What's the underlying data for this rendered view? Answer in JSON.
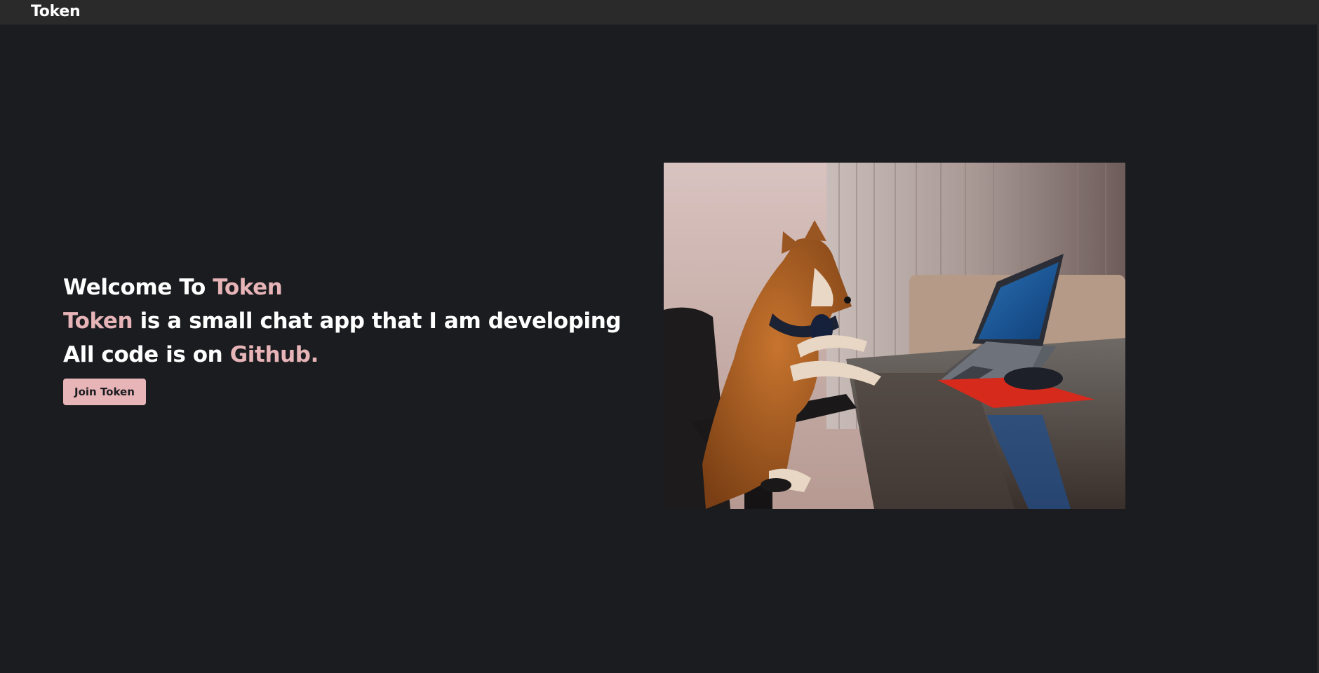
{
  "topbar": {
    "brand": "Token"
  },
  "hero": {
    "welcome_prefix": "Welcome To ",
    "welcome_accent": "Token",
    "desc_accent": "Token",
    "desc_rest": " is a small chat app that I am developing",
    "code_prefix": "All code is on ",
    "code_accent": "Github.",
    "join_label": "Join Token"
  },
  "colors": {
    "background": "#1b1c20",
    "topbar": "#2a2a2b",
    "accent": "#e7b4b7",
    "text": "#ffffff"
  }
}
